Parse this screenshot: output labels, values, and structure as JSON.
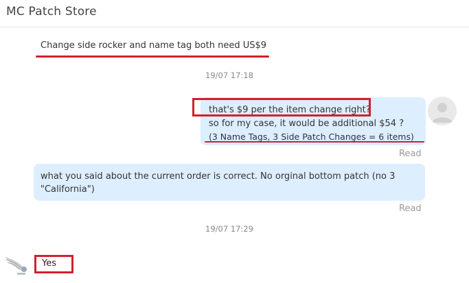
{
  "header": {
    "title": "MC Patch Store"
  },
  "messages": {
    "store_intro": "Change side rocker and name tag both need US$9",
    "time1": "19/07 17:18",
    "user_msg": {
      "line1": "that's $9 per the item change right?",
      "line2": "so for my case, it would be additional $54 ?",
      "line3": "(3 Name Tags, 3 Side Patch Changes = 6 items)"
    },
    "read1": "Read",
    "user_msg2": {
      "line1": "what you said about the current order is correct. No orginal bottom patch (no 3",
      "line2": "\"California\")"
    },
    "read2": "Read",
    "time2": "19/07 17:29",
    "store_reply": "Yes"
  },
  "colors": {
    "bubble": "#ddeeff",
    "highlight": "#d0202e",
    "meta_text": "#9a9a9a"
  },
  "icons": {
    "user_avatar": "user-avatar-icon",
    "store_avatar": "store-logo-icon"
  }
}
